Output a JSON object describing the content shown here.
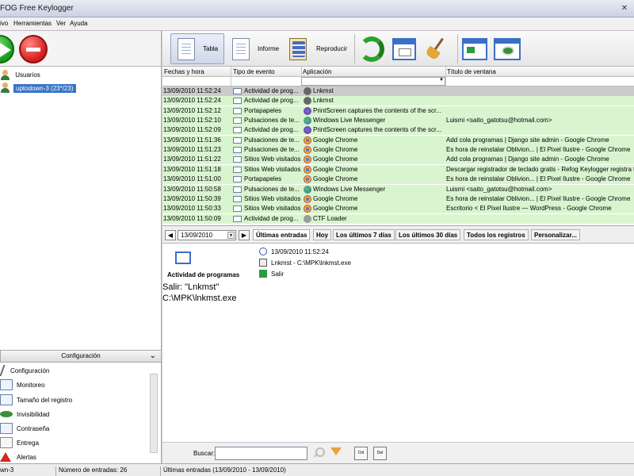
{
  "window": {
    "title": "FOG Free Keylogger"
  },
  "menu": [
    "ivo",
    "Herramientas",
    "Ver",
    "Ayuda"
  ],
  "toolbar": {
    "tabla": "Tabla",
    "informe": "Informe",
    "reproducir": "Reproducir"
  },
  "tree": {
    "root": "Usuarios",
    "user": "uptodown-3 (23*/23)"
  },
  "table": {
    "columns": [
      "Fechas y hora",
      "Tipo de evento",
      "Aplicación",
      "Título de ventana"
    ],
    "rows": [
      [
        "13/09/2010 11:52:24",
        "Actividad de prog...",
        "Lnkmst",
        ""
      ],
      [
        "13/09/2010 11:52:24",
        "Actividad de prog...",
        "Lnkmst",
        ""
      ],
      [
        "13/09/2010 11:52:12",
        "Portapapeles",
        "PrintScreen captures the contents of the scr...",
        ""
      ],
      [
        "13/09/2010 11:52:10",
        "Pulsaciones de te...",
        "Windows Live Messenger",
        "Luismi <saito_gatotsu@hotmail.com>"
      ],
      [
        "13/09/2010 11:52:09",
        "Actividad de prog...",
        "PrintScreen captures the contents of the scr...",
        ""
      ],
      [
        "13/09/2010 11:51:36",
        "Pulsaciones de te...",
        "Google Chrome",
        "Add cola programas | Django site admin - Google Chrome"
      ],
      [
        "13/09/2010 11:51:23",
        "Pulsaciones de te...",
        "Google Chrome",
        "Es hora de reinstalar Oblivion... | El Pixel Ilustre - Google Chrome"
      ],
      [
        "13/09/2010 11:51:22",
        "Sitios Web visitados",
        "Google Chrome",
        "Add cola programas | Django site admin - Google Chrome"
      ],
      [
        "13/09/2010 11:51:18",
        "Sitios Web visitados",
        "Google Chrome",
        "Descargar registrador de teclado gratis - Refog Keylogger registra te"
      ],
      [
        "13/09/2010 11:51:00",
        "Portapapeles",
        "Google Chrome",
        "Es hora de reinstalar Oblivion... | El Pixel Ilustre - Google Chrome"
      ],
      [
        "13/09/2010 11:50:58",
        "Pulsaciones de te...",
        "Windows Live Messenger",
        "Luismi <saito_gatotsu@hotmail.com>"
      ],
      [
        "13/09/2010 11:50:39",
        "Sitios Web visitados",
        "Google Chrome",
        "Es hora de reinstalar Oblivion... | El Pixel Ilustre - Google Chrome"
      ],
      [
        "13/09/2010 11:50:33",
        "Sitios Web visitados",
        "Google Chrome",
        "Escritorio < El Pixel Ilustre — WordPress - Google Chrome"
      ],
      [
        "13/09/2010 11:50:09",
        "Actividad de prog...",
        "CTF Loader",
        ""
      ]
    ]
  },
  "nav": {
    "date": "13/09/2010",
    "tabs": [
      "Últimas entradas",
      "Hoy",
      "Los últimos 7 días",
      "Los últimos 30 días",
      "Todos los registros",
      "Personalizar..."
    ]
  },
  "detail": {
    "type": "Actividad de programas",
    "time": "13/09/2010 11:52:24",
    "app": "Lnkmst - C:\\MPK\\lnkmst.exe",
    "action": "Salir",
    "text_line1": "Salir: \"Lnkmst\"",
    "text_line2": "C:\\MPK\\lnkmst.exe"
  },
  "config": {
    "header": "Configuración",
    "items": [
      "Configuración",
      "Monitoreo",
      "Tamaño del registro",
      "Invisibilidad",
      "Contraseña",
      "Entrega",
      "Alertas"
    ]
  },
  "search": {
    "label": "Buscar:",
    "value": "",
    "btn1": "Ctrl",
    "btn2": "Del"
  },
  "status": {
    "user": "wn-3",
    "count": "Número de entradas: 26",
    "range": "Últimas entradas (13/09/2010 - 13/09/2010)"
  },
  "colors": {
    "row_bg": "#d9f5d0",
    "row_selected": "#cbcbcb",
    "selection_blue": "#3874c8"
  }
}
